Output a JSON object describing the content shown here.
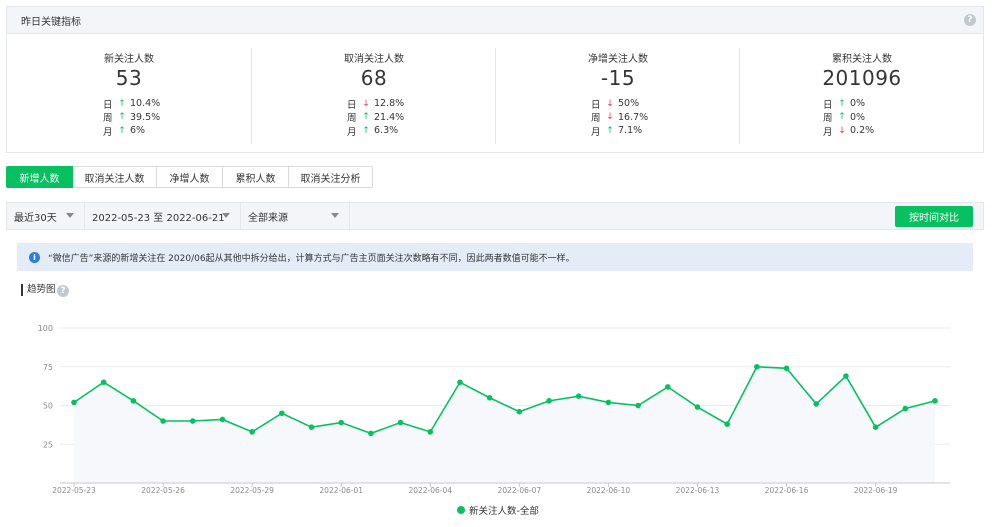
{
  "kpi": {
    "header": "昨日关键指标",
    "help": "?",
    "cards": [
      {
        "title": "新关注人数",
        "value": "53",
        "rows": [
          {
            "label": "日",
            "dir": "up",
            "pct": "10.4%"
          },
          {
            "label": "周",
            "dir": "up",
            "pct": "39.5%"
          },
          {
            "label": "月",
            "dir": "up",
            "pct": "6%"
          }
        ]
      },
      {
        "title": "取消关注人数",
        "value": "68",
        "rows": [
          {
            "label": "日",
            "dir": "down",
            "pct": "12.8%"
          },
          {
            "label": "周",
            "dir": "up",
            "pct": "21.4%"
          },
          {
            "label": "月",
            "dir": "up",
            "pct": "6.3%"
          }
        ]
      },
      {
        "title": "净增关注人数",
        "value": "-15",
        "rows": [
          {
            "label": "日",
            "dir": "down",
            "pct": "50%"
          },
          {
            "label": "周",
            "dir": "down",
            "pct": "16.7%"
          },
          {
            "label": "月",
            "dir": "up",
            "pct": "7.1%"
          }
        ]
      },
      {
        "title": "累积关注人数",
        "value": "201096",
        "rows": [
          {
            "label": "日",
            "dir": "up",
            "pct": "0%"
          },
          {
            "label": "周",
            "dir": "up",
            "pct": "0%"
          },
          {
            "label": "月",
            "dir": "down",
            "pct": "0.2%"
          }
        ]
      }
    ]
  },
  "tabs": [
    {
      "label": "新增人数",
      "active": true
    },
    {
      "label": "取消关注人数",
      "active": false
    },
    {
      "label": "净增人数",
      "active": false
    },
    {
      "label": "累积人数",
      "active": false
    },
    {
      "label": "取消关注分析",
      "active": false
    }
  ],
  "filters": {
    "period": "最近30天",
    "date_range": "2022-05-23 至 2022-06-21",
    "source": "全部来源",
    "compare_button": "按时间对比"
  },
  "notice": {
    "icon": "i",
    "text": "“微信广告”来源的新增关注在 2020/06起从其他中拆分给出，计算方式与广告主页面关注次数略有不同，因此两者数值可能不一样。"
  },
  "trend": {
    "title": "趋势图",
    "help": "?"
  },
  "colors": {
    "accent": "#07c160",
    "up": "#07c160",
    "down": "#e64340",
    "info": "#2a7de1"
  },
  "chart_data": {
    "type": "line",
    "ylim": [
      0,
      100
    ],
    "yticks": [
      25,
      50,
      75,
      100
    ],
    "grid": true,
    "legend_position": "bottom",
    "x": [
      "2022-05-23",
      "2022-05-24",
      "2022-05-25",
      "2022-05-26",
      "2022-05-27",
      "2022-05-28",
      "2022-05-29",
      "2022-05-30",
      "2022-05-31",
      "2022-06-01",
      "2022-06-02",
      "2022-06-03",
      "2022-06-04",
      "2022-06-05",
      "2022-06-06",
      "2022-06-07",
      "2022-06-08",
      "2022-06-09",
      "2022-06-10",
      "2022-06-11",
      "2022-06-12",
      "2022-06-13",
      "2022-06-14",
      "2022-06-15",
      "2022-06-16",
      "2022-06-17",
      "2022-06-18",
      "2022-06-19",
      "2022-06-20",
      "2022-06-21"
    ],
    "xtick_labels": [
      "2022-05-23",
      "2022-05-26",
      "2022-05-29",
      "2022-06-01",
      "2022-06-04",
      "2022-06-07",
      "2022-06-10",
      "2022-06-13",
      "2022-06-16",
      "2022-06-19"
    ],
    "series": [
      {
        "name": "新关注人数-全部",
        "values": [
          52,
          65,
          53,
          40,
          40,
          41,
          33,
          45,
          36,
          39,
          32,
          39,
          33,
          65,
          55,
          46,
          53,
          56,
          52,
          50,
          62,
          49,
          38,
          75,
          74,
          51,
          69,
          36,
          48,
          53
        ]
      }
    ]
  }
}
